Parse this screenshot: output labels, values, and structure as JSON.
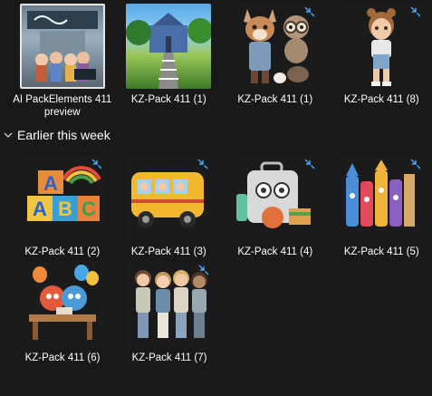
{
  "folder": {
    "group_label": "Earlier this week",
    "items_top": [
      {
        "label": "AI PackElements 411 preview",
        "kind": "preview"
      },
      {
        "label": "KZ-Pack 411 (1)",
        "kind": "school"
      },
      {
        "label": "KZ-Pack 411 (1)",
        "kind": "animals"
      },
      {
        "label": "KZ-Pack 411 (8)",
        "kind": "girl"
      }
    ],
    "items_week": [
      {
        "label": "KZ-Pack 411 (2)",
        "kind": "blocks"
      },
      {
        "label": "KZ-Pack 411 (3)",
        "kind": "bus"
      },
      {
        "label": "KZ-Pack 411 (4)",
        "kind": "lunchbox"
      },
      {
        "label": "KZ-Pack 411 (5)",
        "kind": "crayons"
      },
      {
        "label": "KZ-Pack 411 (6)",
        "kind": "desk"
      },
      {
        "label": "KZ-Pack 411 (7)",
        "kind": "kids"
      }
    ]
  },
  "colors": {
    "background": "#191919",
    "accent_badge": "#4aa8ff",
    "text": "#ffffff"
  },
  "icons": {
    "badge": "arrows-in-icon",
    "chevron": "chevron-down-icon"
  }
}
